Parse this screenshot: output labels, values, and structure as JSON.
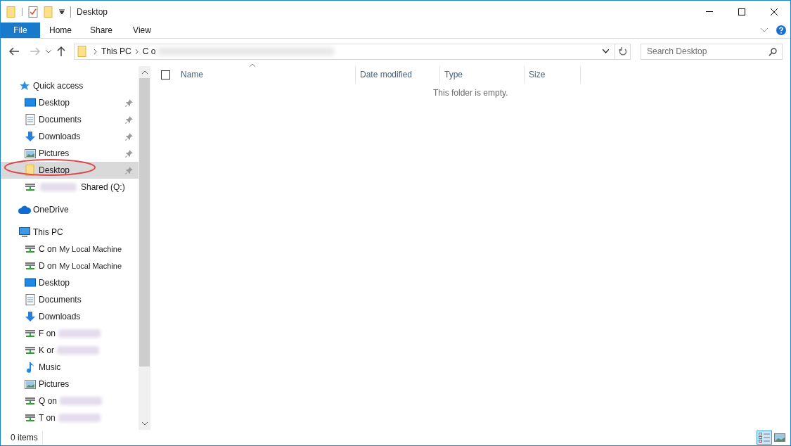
{
  "window": {
    "title": "Desktop"
  },
  "ribbon_tabs": [
    {
      "label": "File",
      "selected": false,
      "kind": "file"
    },
    {
      "label": "Home",
      "selected": false,
      "kind": "tab"
    },
    {
      "label": "Share",
      "selected": false,
      "kind": "tab"
    },
    {
      "label": "View",
      "selected": false,
      "kind": "tab"
    }
  ],
  "address": {
    "crumbs": [
      "This PC",
      "C o"
    ]
  },
  "search": {
    "placeholder": "Search Desktop"
  },
  "nav_tree": [
    {
      "label": "Quick access",
      "kind": "star",
      "selected": false,
      "children": [
        {
          "label": "Desktop",
          "kind": "desktop",
          "pinned": true,
          "selected": false
        },
        {
          "label": "Documents",
          "kind": "documents",
          "pinned": true,
          "selected": false
        },
        {
          "label": "Downloads",
          "kind": "downloads",
          "pinned": true,
          "selected": false
        },
        {
          "label": "Pictures",
          "kind": "pictures",
          "pinned": true,
          "selected": false
        },
        {
          "label": "Desktop",
          "kind": "folder",
          "pinned": true,
          "selected": true
        },
        {
          "label": "Shared (Q:)",
          "kind": "drive",
          "pinned": false,
          "selected": false,
          "blurred_prefix": true
        }
      ]
    },
    {
      "label": "OneDrive",
      "kind": "cloud",
      "selected": false
    },
    {
      "label": "This PC",
      "kind": "pc",
      "selected": false,
      "children": [
        {
          "label": "C on",
          "note": "My Local Machine",
          "kind": "drive",
          "selected": false
        },
        {
          "label": "D on",
          "note": "My Local Machine",
          "kind": "drive",
          "selected": false
        },
        {
          "label": "Desktop",
          "kind": "desktop",
          "selected": false
        },
        {
          "label": "Documents",
          "kind": "documents",
          "selected": false
        },
        {
          "label": "Downloads",
          "kind": "downloads",
          "selected": false
        },
        {
          "label": "F on",
          "kind": "drive",
          "selected": false,
          "blurred_suffix": true
        },
        {
          "label": "K or",
          "kind": "drive",
          "selected": false,
          "blurred_suffix": true
        },
        {
          "label": "Music",
          "kind": "music",
          "selected": false
        },
        {
          "label": "Pictures",
          "kind": "pictures",
          "selected": false
        },
        {
          "label": "Q on",
          "kind": "drive",
          "selected": false,
          "blurred_suffix": true
        },
        {
          "label": "T on",
          "kind": "drive",
          "selected": false,
          "blurred_suffix": true
        }
      ]
    }
  ],
  "header_checkbox": {
    "checked": false
  },
  "columns": [
    "Name",
    "Date modified",
    "Type",
    "Size"
  ],
  "empty_message": "This folder is empty.",
  "status_bar": {
    "items": "0 items"
  },
  "view_buttons": [
    {
      "kind": "details",
      "selected": true
    },
    {
      "kind": "tiles",
      "selected": false
    }
  ]
}
